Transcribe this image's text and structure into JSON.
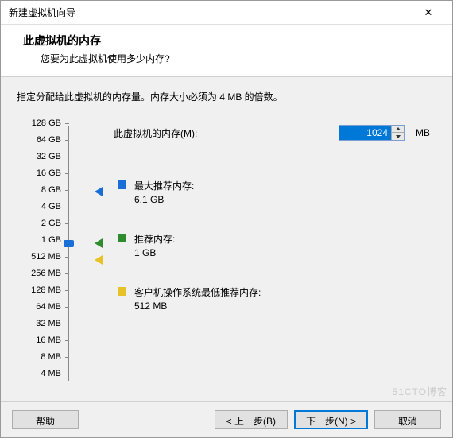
{
  "window": {
    "title": "新建虚拟机向导"
  },
  "header": {
    "title": "此虚拟机的内存",
    "subtitle": "您要为此虚拟机使用多少内存?"
  },
  "instruction": "指定分配给此虚拟机的内存量。内存大小必须为 4 MB 的倍数。",
  "memory": {
    "label_pre": "此虚拟机的内存(",
    "label_hotkey": "M",
    "label_post": "):",
    "value": "1024",
    "unit": "MB"
  },
  "slider": {
    "ticks": [
      "128 GB",
      "64 GB",
      "32 GB",
      "16 GB",
      "8 GB",
      "4 GB",
      "2 GB",
      "1 GB",
      "512 MB",
      "256 MB",
      "128 MB",
      "64 MB",
      "32 MB",
      "16 MB",
      "8 MB",
      "4 MB"
    ]
  },
  "markers": {
    "max": {
      "color": "#1a6fd6",
      "title": "最大推荐内存:",
      "value": "6.1 GB"
    },
    "rec": {
      "color": "#2e8b2e",
      "title": "推荐内存:",
      "value": "1 GB"
    },
    "min": {
      "color": "#e6c226",
      "title": "客户机操作系统最低推荐内存:",
      "value": "512 MB"
    }
  },
  "buttons": {
    "help": "帮助",
    "back": "< 上一步(B)",
    "next": "下一步(N) >",
    "cancel": "取消"
  },
  "watermark": "51CTO博客"
}
